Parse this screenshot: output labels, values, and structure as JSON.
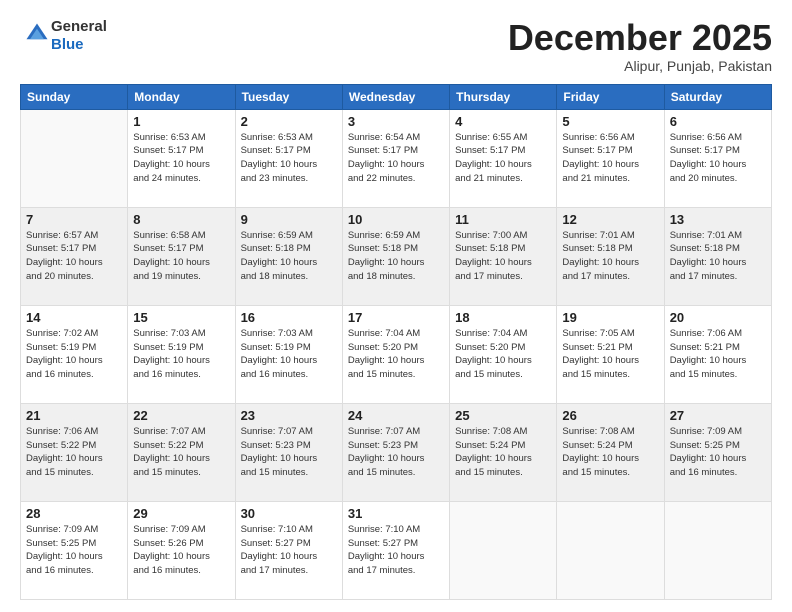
{
  "header": {
    "logo_general": "General",
    "logo_blue": "Blue",
    "month": "December 2025",
    "location": "Alipur, Punjab, Pakistan"
  },
  "days_of_week": [
    "Sunday",
    "Monday",
    "Tuesday",
    "Wednesday",
    "Thursday",
    "Friday",
    "Saturday"
  ],
  "weeks": [
    {
      "shaded": false,
      "days": [
        {
          "date": "",
          "info": ""
        },
        {
          "date": "1",
          "info": "Sunrise: 6:53 AM\nSunset: 5:17 PM\nDaylight: 10 hours\nand 24 minutes."
        },
        {
          "date": "2",
          "info": "Sunrise: 6:53 AM\nSunset: 5:17 PM\nDaylight: 10 hours\nand 23 minutes."
        },
        {
          "date": "3",
          "info": "Sunrise: 6:54 AM\nSunset: 5:17 PM\nDaylight: 10 hours\nand 22 minutes."
        },
        {
          "date": "4",
          "info": "Sunrise: 6:55 AM\nSunset: 5:17 PM\nDaylight: 10 hours\nand 21 minutes."
        },
        {
          "date": "5",
          "info": "Sunrise: 6:56 AM\nSunset: 5:17 PM\nDaylight: 10 hours\nand 21 minutes."
        },
        {
          "date": "6",
          "info": "Sunrise: 6:56 AM\nSunset: 5:17 PM\nDaylight: 10 hours\nand 20 minutes."
        }
      ]
    },
    {
      "shaded": true,
      "days": [
        {
          "date": "7",
          "info": "Sunrise: 6:57 AM\nSunset: 5:17 PM\nDaylight: 10 hours\nand 20 minutes."
        },
        {
          "date": "8",
          "info": "Sunrise: 6:58 AM\nSunset: 5:17 PM\nDaylight: 10 hours\nand 19 minutes."
        },
        {
          "date": "9",
          "info": "Sunrise: 6:59 AM\nSunset: 5:18 PM\nDaylight: 10 hours\nand 18 minutes."
        },
        {
          "date": "10",
          "info": "Sunrise: 6:59 AM\nSunset: 5:18 PM\nDaylight: 10 hours\nand 18 minutes."
        },
        {
          "date": "11",
          "info": "Sunrise: 7:00 AM\nSunset: 5:18 PM\nDaylight: 10 hours\nand 17 minutes."
        },
        {
          "date": "12",
          "info": "Sunrise: 7:01 AM\nSunset: 5:18 PM\nDaylight: 10 hours\nand 17 minutes."
        },
        {
          "date": "13",
          "info": "Sunrise: 7:01 AM\nSunset: 5:18 PM\nDaylight: 10 hours\nand 17 minutes."
        }
      ]
    },
    {
      "shaded": false,
      "days": [
        {
          "date": "14",
          "info": "Sunrise: 7:02 AM\nSunset: 5:19 PM\nDaylight: 10 hours\nand 16 minutes."
        },
        {
          "date": "15",
          "info": "Sunrise: 7:03 AM\nSunset: 5:19 PM\nDaylight: 10 hours\nand 16 minutes."
        },
        {
          "date": "16",
          "info": "Sunrise: 7:03 AM\nSunset: 5:19 PM\nDaylight: 10 hours\nand 16 minutes."
        },
        {
          "date": "17",
          "info": "Sunrise: 7:04 AM\nSunset: 5:20 PM\nDaylight: 10 hours\nand 15 minutes."
        },
        {
          "date": "18",
          "info": "Sunrise: 7:04 AM\nSunset: 5:20 PM\nDaylight: 10 hours\nand 15 minutes."
        },
        {
          "date": "19",
          "info": "Sunrise: 7:05 AM\nSunset: 5:21 PM\nDaylight: 10 hours\nand 15 minutes."
        },
        {
          "date": "20",
          "info": "Sunrise: 7:06 AM\nSunset: 5:21 PM\nDaylight: 10 hours\nand 15 minutes."
        }
      ]
    },
    {
      "shaded": true,
      "days": [
        {
          "date": "21",
          "info": "Sunrise: 7:06 AM\nSunset: 5:22 PM\nDaylight: 10 hours\nand 15 minutes."
        },
        {
          "date": "22",
          "info": "Sunrise: 7:07 AM\nSunset: 5:22 PM\nDaylight: 10 hours\nand 15 minutes."
        },
        {
          "date": "23",
          "info": "Sunrise: 7:07 AM\nSunset: 5:23 PM\nDaylight: 10 hours\nand 15 minutes."
        },
        {
          "date": "24",
          "info": "Sunrise: 7:07 AM\nSunset: 5:23 PM\nDaylight: 10 hours\nand 15 minutes."
        },
        {
          "date": "25",
          "info": "Sunrise: 7:08 AM\nSunset: 5:24 PM\nDaylight: 10 hours\nand 15 minutes."
        },
        {
          "date": "26",
          "info": "Sunrise: 7:08 AM\nSunset: 5:24 PM\nDaylight: 10 hours\nand 15 minutes."
        },
        {
          "date": "27",
          "info": "Sunrise: 7:09 AM\nSunset: 5:25 PM\nDaylight: 10 hours\nand 16 minutes."
        }
      ]
    },
    {
      "shaded": false,
      "days": [
        {
          "date": "28",
          "info": "Sunrise: 7:09 AM\nSunset: 5:25 PM\nDaylight: 10 hours\nand 16 minutes."
        },
        {
          "date": "29",
          "info": "Sunrise: 7:09 AM\nSunset: 5:26 PM\nDaylight: 10 hours\nand 16 minutes."
        },
        {
          "date": "30",
          "info": "Sunrise: 7:10 AM\nSunset: 5:27 PM\nDaylight: 10 hours\nand 17 minutes."
        },
        {
          "date": "31",
          "info": "Sunrise: 7:10 AM\nSunset: 5:27 PM\nDaylight: 10 hours\nand 17 minutes."
        },
        {
          "date": "",
          "info": ""
        },
        {
          "date": "",
          "info": ""
        },
        {
          "date": "",
          "info": ""
        }
      ]
    }
  ]
}
